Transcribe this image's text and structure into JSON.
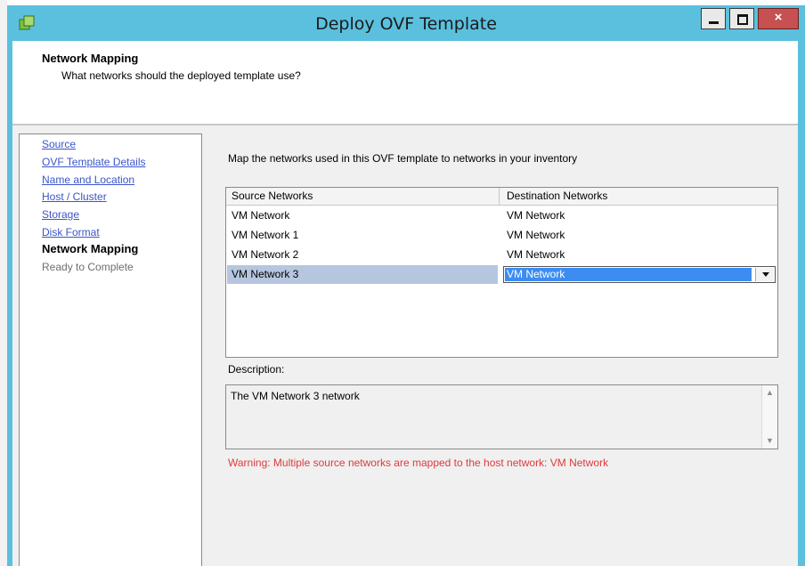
{
  "window": {
    "title": "Deploy OVF Template",
    "close_glyph": "×"
  },
  "header": {
    "title": "Network Mapping",
    "subtitle": "What networks should the deployed template use?"
  },
  "nav": {
    "items": [
      {
        "label": "Source",
        "state": "link"
      },
      {
        "label": "OVF Template Details",
        "state": "link"
      },
      {
        "label": "Name and Location",
        "state": "link"
      },
      {
        "label": "Host / Cluster",
        "state": "link"
      },
      {
        "label": "Storage",
        "state": "link"
      },
      {
        "label": "Disk Format",
        "state": "link"
      },
      {
        "label": "Network Mapping",
        "state": "current"
      },
      {
        "label": "Ready to Complete",
        "state": "pending"
      }
    ]
  },
  "mapping": {
    "intro": "Map the networks used in this OVF template to networks in your inventory",
    "columns": {
      "source": "Source Networks",
      "destination": "Destination Networks"
    },
    "rows": [
      {
        "source": "VM Network",
        "destination": "VM Network"
      },
      {
        "source": "VM Network 1",
        "destination": "VM Network"
      },
      {
        "source": "VM Network 2",
        "destination": "VM Network"
      },
      {
        "source": "VM Network 3",
        "destination": "VM Network",
        "selected": true
      }
    ]
  },
  "description": {
    "label": "Description:",
    "text": "The VM Network 3 network"
  },
  "warning": "Warning: Multiple source networks are mapped to the host network: VM Network",
  "colors": {
    "titlebar": "#5bc0de",
    "link": "#3b55c8",
    "warning": "#e03a3a",
    "selection": "#3c8cf1"
  }
}
